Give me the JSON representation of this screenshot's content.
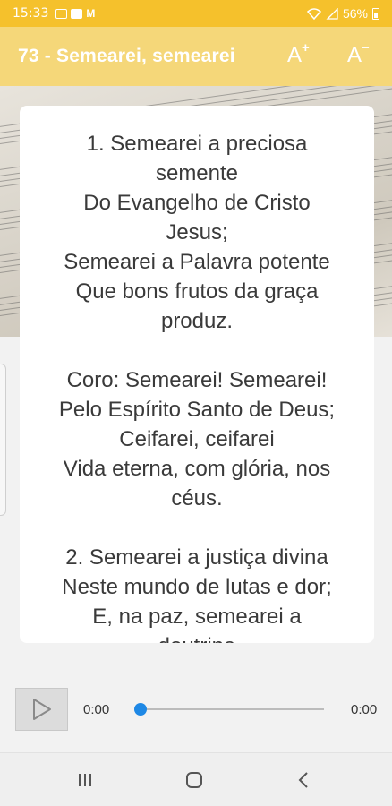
{
  "status_bar": {
    "time": "15:33",
    "battery": "56%",
    "icons": [
      "image-icon",
      "youtube-icon",
      "gmail-icon",
      "wifi-icon",
      "signal-icon",
      "battery-icon"
    ]
  },
  "app_bar": {
    "title": "73 - Semearei, semearei",
    "font_increase_label": "A",
    "font_increase_sup": "+",
    "font_decrease_label": "A",
    "font_decrease_sup": "−"
  },
  "lyrics": {
    "verses": [
      "1. Semearei a preciosa\nsemente\nDo Evangelho de Cristo\nJesus;\nSemearei a Palavra potente\nQue bons frutos da graça\nproduz.",
      "Coro: Semearei! Semearei!\nPelo Espírito Santo de Deus;\nCeifarei, ceifarei\nVida eterna, com glória, nos\ncéus.",
      "2. Semearei a justiça divina\nNeste mundo de lutas e dor;\nE, na paz, semearei a\ndoutrina"
    ]
  },
  "player": {
    "current_time": "0:00",
    "total_time": "0:00",
    "progress": 0
  },
  "colors": {
    "status_bar": "#f5c12c",
    "app_bar": "#f5d779",
    "slider_thumb": "#1e88e5"
  }
}
